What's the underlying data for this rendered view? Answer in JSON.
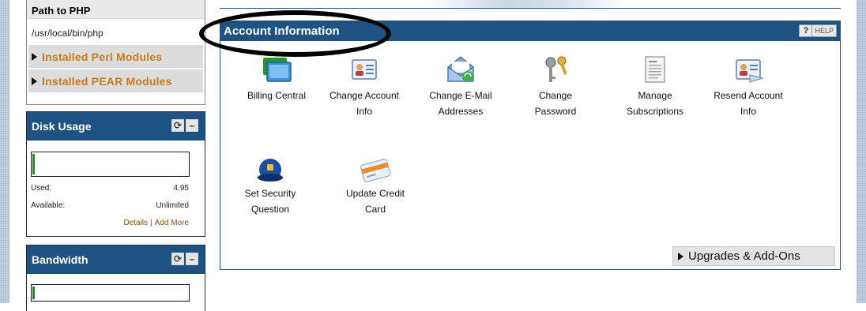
{
  "php_box": {
    "header": "Path to PHP",
    "path": "/usr/local/bin/php",
    "modules": [
      {
        "label": "Installed Perl Modules"
      },
      {
        "label": "Installed PEAR Modules"
      }
    ]
  },
  "disk_usage": {
    "title": "Disk Usage",
    "used_fraction": 0.01,
    "used_label": "Used:",
    "used_value": "4.95",
    "available_label": "Available:",
    "available_value": "Unlimited",
    "details_link": "Details",
    "separator": "|",
    "add_more_link": "Add More"
  },
  "bandwidth": {
    "title": "Bandwidth",
    "used_fraction": 0.01
  },
  "account": {
    "title": "Account Information",
    "help_q": "?",
    "help_label": "HELP",
    "tools": [
      {
        "name": "billing-central",
        "line1": "Billing Central",
        "line2": "",
        "icon": "monitor-icon"
      },
      {
        "name": "change-account-info",
        "line1": "Change Account",
        "line2": "Info",
        "icon": "id-card-icon"
      },
      {
        "name": "change-email",
        "line1": "Change E-Mail",
        "line2": "Addresses",
        "icon": "envelope-icon"
      },
      {
        "name": "change-password",
        "line1": "Change",
        "line2": "Password",
        "icon": "keys-icon"
      },
      {
        "name": "manage-subscriptions",
        "line1": "Manage",
        "line2": "Subscriptions",
        "icon": "document-icon"
      },
      {
        "name": "resend-account-info",
        "line1": "Resend Account",
        "line2": "Info",
        "icon": "id-card-icon"
      },
      {
        "name": "set-security-question",
        "line1": "Set Security",
        "line2": "Question",
        "icon": "police-cap-icon"
      },
      {
        "name": "update-credit-card",
        "line1": "Update Credit",
        "line2": "Card",
        "icon": "credit-card-icon"
      }
    ],
    "addons": "Upgrades & Add-Ons"
  },
  "colors": {
    "header_blue": "#1e5282",
    "module_orange": "#c87a1c",
    "usage_green": "#1c8a1c"
  }
}
